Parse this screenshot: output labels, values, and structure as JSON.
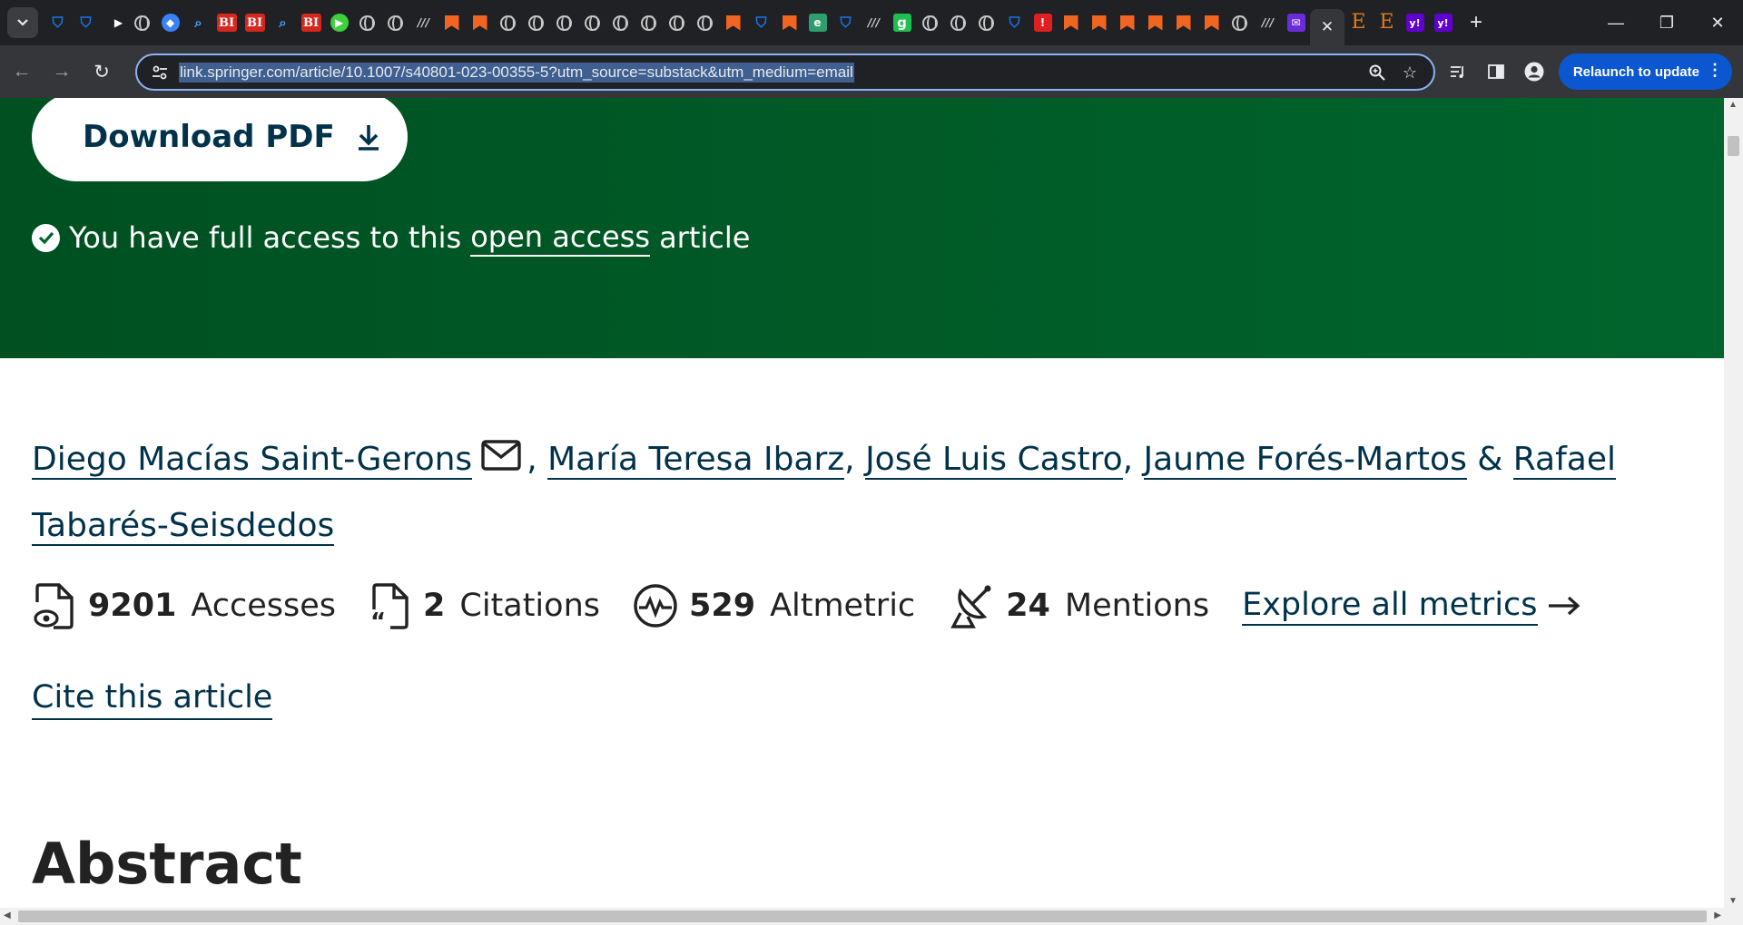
{
  "browser": {
    "tab_favicons": [
      "shield",
      "shield",
      "arrow",
      "globe",
      "grad",
      "mag",
      "bi",
      "bi",
      "mag",
      "bi",
      "play",
      "globe",
      "globe",
      "lmo",
      "bookmark",
      "bookmark",
      "globe",
      "globe",
      "globe",
      "globe",
      "globe",
      "globe",
      "globe",
      "globe",
      "bookmark",
      "shield",
      "bookmark",
      "ep",
      "shield",
      "lmo",
      "g",
      "globe",
      "globe",
      "globe",
      "shield",
      "red",
      "bookmark",
      "bookmark",
      "bookmark",
      "bookmark",
      "bookmark",
      "bookmark",
      "globe",
      "lmo",
      "env"
    ],
    "tab_favicons_after": [
      "e",
      "e",
      "y",
      "y"
    ],
    "favicon_text": {
      "bi": "BI",
      "g": "g",
      "e": "E",
      "y": "y!",
      "red": "!",
      "mag": "⌕",
      "shield": "⛉",
      "lmo": "///",
      "play": "▶",
      "grad": "◆",
      "ep": "e",
      "env": "✉",
      "arrow": "▶"
    },
    "active_tab_close": "✕",
    "new_tab": "+",
    "url": "link.springer.com/article/10.1007/s40801-023-00355-5?utm_source=substack&utm_medium=email",
    "relaunch_label": "Relaunch to update",
    "window": {
      "minimize": "—",
      "restore": "❐",
      "close": "✕"
    }
  },
  "hero": {
    "download_label": "Download PDF",
    "access_prefix": "You have full access to this",
    "access_link": "open access",
    "access_suffix": "article",
    "colors": {
      "bg_left": "#005021",
      "bg_right": "#00652c",
      "text": "#01324b"
    }
  },
  "authors": [
    {
      "name": "Diego Macías Saint-Gerons",
      "has_email": true
    },
    {
      "name": "María Teresa Ibarz"
    },
    {
      "name": "José Luis Castro"
    },
    {
      "name": "Jaume Forés-Martos"
    },
    {
      "name": "Rafael Tabarés-Seisdedos"
    }
  ],
  "authors_joiner_last": "&",
  "metrics": [
    {
      "icon": "accesses-icon",
      "value": "9201",
      "label": "Accesses"
    },
    {
      "icon": "citations-icon",
      "value": "2",
      "label": "Citations"
    },
    {
      "icon": "altmetric-icon",
      "value": "529",
      "label": "Altmetric"
    },
    {
      "icon": "mentions-icon",
      "value": "24",
      "label": "Mentions"
    }
  ],
  "explore_label": "Explore all metrics",
  "cite_label": "Cite this article",
  "abstract_heading": "Abstract"
}
